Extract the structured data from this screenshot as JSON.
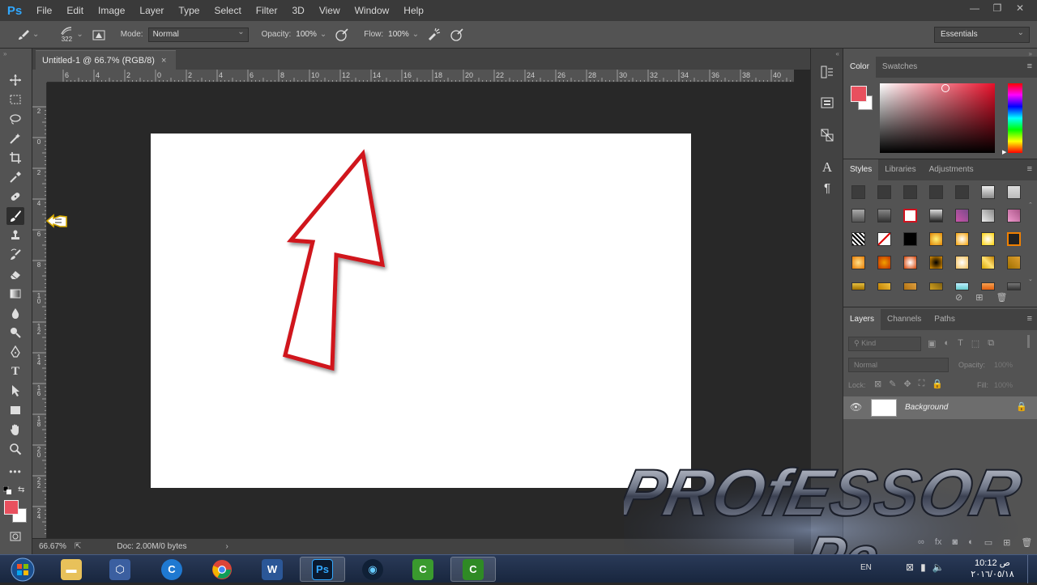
{
  "app": {
    "logo": "Ps",
    "menu": [
      "File",
      "Edit",
      "Image",
      "Layer",
      "Type",
      "Select",
      "Filter",
      "3D",
      "View",
      "Window",
      "Help"
    ],
    "window_controls": [
      "—",
      "❐",
      "✕"
    ]
  },
  "options_bar": {
    "brush_size": "322",
    "mode_label": "Mode:",
    "mode_value": "Normal",
    "opacity_label": "Opacity:",
    "opacity_value": "100%",
    "flow_label": "Flow:",
    "flow_value": "100%",
    "workspace": "Essentials"
  },
  "document": {
    "tab_title": "Untitled-1 @ 66.7% (RGB/8)",
    "close_glyph": "×",
    "zoom": "66.67%",
    "doc_info": "Doc: 2.00M/0 bytes",
    "canvas_color": "#ffffff",
    "arrow_stroke_color": "#d0121f"
  },
  "rulers": {
    "top": [
      "6",
      "4",
      "2",
      "0",
      "2",
      "4",
      "6",
      "8",
      "10",
      "12",
      "14",
      "16",
      "18",
      "20",
      "22",
      "24",
      "26",
      "28",
      "30",
      "32",
      "34",
      "36",
      "38",
      "40"
    ],
    "left": [
      "2",
      "0",
      "2",
      "4",
      "6",
      "8",
      "10",
      "12",
      "14",
      "16",
      "18",
      "20",
      "22",
      "24"
    ]
  },
  "color_panel": {
    "tabs": [
      "Color",
      "Swatches"
    ],
    "foreground": "#e8505e",
    "background": "#ffffff",
    "hue_color": "#e8102a"
  },
  "styles_panel": {
    "tabs": [
      "Styles",
      "Libraries",
      "Adjustments"
    ]
  },
  "layers_panel": {
    "tabs": [
      "Layers",
      "Channels",
      "Paths"
    ],
    "filter_kind": "Kind",
    "blend_mode": "Normal",
    "opacity_label": "Opacity:",
    "opacity_value": "100%",
    "lock_label": "Lock:",
    "fill_label": "Fill:",
    "fill_value": "100%",
    "layers": [
      {
        "name": "Background",
        "visible": true,
        "locked": true
      }
    ]
  },
  "taskbar": {
    "time": "10:12 ص",
    "date": "٢٠١٦/٠٥/١٨",
    "lang": "EN"
  },
  "watermark": {
    "line1": "PROfESSOR",
    "line2": "Pc"
  }
}
